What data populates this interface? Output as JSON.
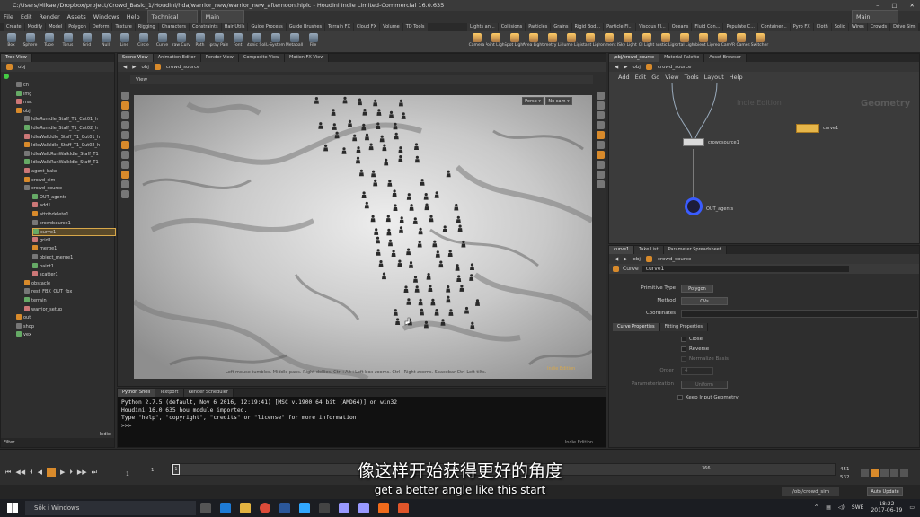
{
  "window": {
    "title": "C:/Users/Mikael/Dropbox/project/Crowd_Basic_1/Houdini/hda/warrior_new/warrior_new_afternoon.hiplc - Houdini Indie Limited-Commercial 16.0.635"
  },
  "menu": {
    "items": [
      "File",
      "Edit",
      "Render",
      "Assets",
      "Windows",
      "Help"
    ],
    "desktop": "Technical",
    "main": "Main",
    "main_right": "Main"
  },
  "shelf": {
    "tabs": [
      "Create",
      "Modify",
      "Model",
      "Polygon",
      "Deform",
      "Texture",
      "Rigging",
      "Characters",
      "Constraints",
      "Hair Utils",
      "Guide Process",
      "Guide Brushes",
      "Terrain FX",
      "Cloud FX",
      "Volume",
      "TD Tools"
    ],
    "tools": [
      "Box",
      "Sphere",
      "Tube",
      "Torus",
      "Grid",
      "Null",
      "Line",
      "Circle",
      "Curve",
      "Draw Curve",
      "Path",
      "Spray Paint",
      "Font",
      "Platonic Solids",
      "L-System",
      "Metaball",
      "File"
    ],
    "tabs_right": [
      "Lights an...",
      "Collisions",
      "Particles",
      "Grains",
      "Rigid Bod...",
      "Particle Fl...",
      "Viscous Fl...",
      "Oceans",
      "Fluid Con...",
      "Populate C...",
      "Container...",
      "Pyro FX",
      "Cloth",
      "Solid",
      "Wires",
      "Crowds",
      "Drive Sim"
    ],
    "tools_right": [
      "Camera",
      "Point Light",
      "Spot Light",
      "Area Light",
      "Geometry Light",
      "Volume Light",
      "Distant Light",
      "Environment Light",
      "Sky Light",
      "GI Light",
      "Caustic Light",
      "Portal Light",
      "Ambient Light",
      "Stereo Camera",
      "VR Camera",
      "Switcher"
    ]
  },
  "tree": {
    "tabs": [
      "Tree View"
    ],
    "path": "obj",
    "items": [
      "ch",
      "img",
      "mat",
      "obj",
      "IdleRunIdle_Staff_T1_Cut01_h",
      "IdleRunIdle_Staff_T1_Cut02_h",
      "IdleWalkIdle_Staff_T1_Cut01_h",
      "IdleWalkIdle_Staff_T1_Cut02_h",
      "IdleWalkRunWalkIdle_Staff_T1",
      "IdleWalkRunWalkIdle_Staff_T1",
      "agent_bake",
      "crowd_sim",
      "crowd_source",
      "OUT_agents",
      "add1",
      "attribdelete1",
      "crowdsource1",
      "curve1",
      "grid1",
      "merge1",
      "object_merge1",
      "paint1",
      "scatter1",
      "obstacle",
      "rest_FBX_OUT_fbx",
      "terrain",
      "warrior_setup",
      "out",
      "shop",
      "vex"
    ],
    "filter": "Filter"
  },
  "viewport": {
    "tabs": [
      "Scene View",
      "Animation Editor",
      "Render View",
      "Composite View",
      "Motion FX View"
    ],
    "path": {
      "obj": "obj",
      "net": "crowd_source"
    },
    "label": "View",
    "persp": "Persp ▾",
    "cam": "No cam ▾",
    "status": "Left mouse tumbles. Middle pans. Right dollies. Ctrl+Alt+Left box-zooms. Ctrl+Right zooms. Spacebar-Ctrl-Left tilts.",
    "watermark": "Indie Edition"
  },
  "shell": {
    "tabs": [
      "Python Shell",
      "Textport",
      "Render Scheduler"
    ],
    "lines": [
      "Python 2.7.5 (default, Nov  6 2016, 12:19:41) [MSC v.1900 64 bit (AMD64)] on win32",
      "Houdini 16.0.635 hou module imported.",
      "Type \"help\", \"copyright\", \"credits\" or \"license\" for more information.",
      ">>>"
    ],
    "watermark": "Indie Edition",
    "indie": "Indie"
  },
  "network": {
    "tabs": [
      "/obj/crowd_source",
      "Material Palette",
      "Asset Browser"
    ],
    "path": {
      "obj": "obj",
      "net": "crowd_source"
    },
    "menu": [
      "Add",
      "Edit",
      "Go",
      "View",
      "Tools",
      "Layout",
      "Help"
    ],
    "watermark": "Indie Edition",
    "context": "Geometry",
    "nodes": {
      "crowdsource": "crowdsource1",
      "out": "OUT_agents",
      "curve": "curve1"
    }
  },
  "params": {
    "tabs": [
      "curve1",
      "Take List",
      "Parameter Spreadsheet"
    ],
    "path": {
      "obj": "obj",
      "net": "crowd_source"
    },
    "node_type": "Curve",
    "node_name": "curve1",
    "primitive_type": {
      "label": "Primitive Type",
      "value": "Polygon"
    },
    "method": {
      "label": "Method",
      "value": "CVs"
    },
    "coordinates": {
      "label": "Coordinates"
    },
    "subtabs": [
      "Curve Properties",
      "Fitting Properties"
    ],
    "close": "Close",
    "reverse": "Reverse",
    "normalize": "Normalize Basis",
    "order": {
      "label": "Order",
      "value": "4"
    },
    "parameterization": {
      "label": "Parameterization",
      "value": "Uniform"
    },
    "keep": "Keep Input Geometry"
  },
  "timeline": {
    "frame": "1",
    "start": "1",
    "mark": "366",
    "end_a": "451",
    "end_b": "532",
    "tick_1": "1",
    "auto_update": "Auto Update",
    "path": "/obj/crowd_sim"
  },
  "subtitle": {
    "cn": "像这样开始获得更好的角度",
    "en": "get a better angle like this start"
  },
  "taskbar": {
    "search": "Sök i Windows",
    "lang": "SWE",
    "time": "18:22",
    "date": "2017-06-19"
  }
}
